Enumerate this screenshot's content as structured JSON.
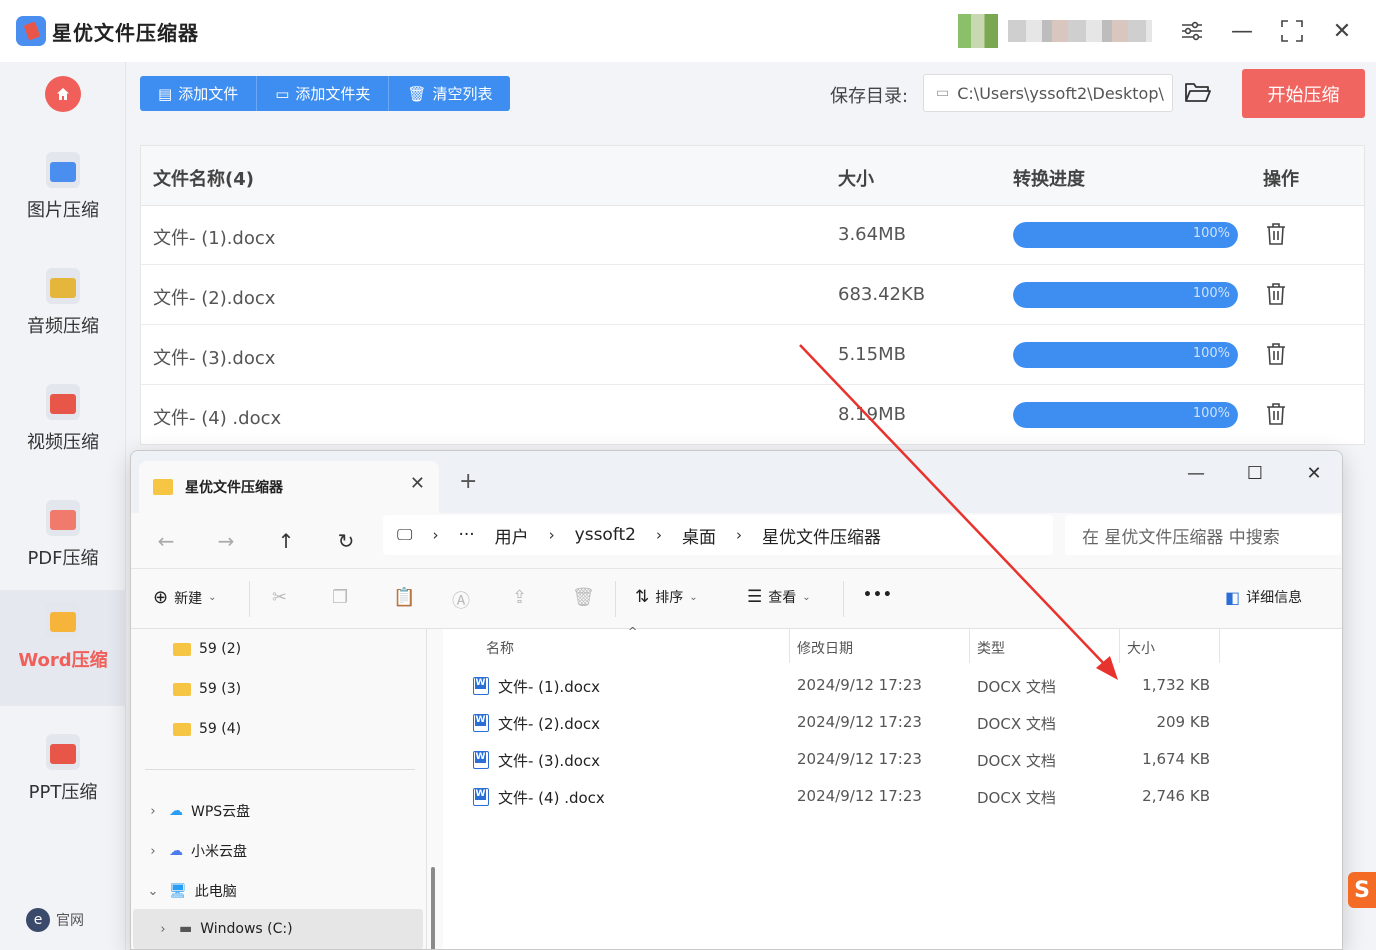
{
  "app": {
    "title": "星优文件压缩器",
    "window_controls": {
      "settings_icon": "sliders-icon",
      "minimize": "—",
      "maximize": "⛶",
      "close": "✕"
    }
  },
  "sidebar": {
    "home_icon": "home-icon",
    "items": [
      {
        "label": "图片压缩",
        "icon": "image-icon",
        "color": "#4a8ff0"
      },
      {
        "label": "音频压缩",
        "icon": "audio-icon",
        "color": "#e6b63c"
      },
      {
        "label": "视频压缩",
        "icon": "video-icon",
        "color": "#e8564a"
      },
      {
        "label": "PDF压缩",
        "icon": "pdf-icon",
        "color": "#f07a6c"
      },
      {
        "label": "Word压缩",
        "icon": "word-icon",
        "color": "#f6b43a",
        "active": true
      },
      {
        "label": "PPT压缩",
        "icon": "ppt-icon",
        "color": "#e8564a"
      }
    ],
    "site_link": {
      "icon_text": "e",
      "label": "官网"
    }
  },
  "toolbar": {
    "add_file": "添加文件",
    "add_folder": "添加文件夹",
    "clear_list": "清空列表",
    "save_dir_label": "保存目录:",
    "save_dir_path": "C:\\Users\\yssoft2\\Desktop\\",
    "start_button": "开始压缩"
  },
  "file_table": {
    "headers": {
      "name": "文件名称(4)",
      "size": "大小",
      "progress": "转换进度",
      "action": "操作"
    },
    "rows": [
      {
        "name": "文件- (1).docx",
        "size": "3.64MB",
        "progress": 1.0,
        "progress_label": "100%"
      },
      {
        "name": "文件- (2).docx",
        "size": "683.42KB",
        "progress": 1.0,
        "progress_label": "100%"
      },
      {
        "name": "文件- (3).docx",
        "size": "5.15MB",
        "progress": 1.0,
        "progress_label": "100%"
      },
      {
        "name": "文件- (4) .docx",
        "size": "8.19MB",
        "progress": 1.0,
        "progress_label": "100%"
      }
    ]
  },
  "explorer": {
    "tab_title": "星优文件压缩器",
    "tab_close": "✕",
    "new_tab": "+",
    "controls": {
      "minimize": "—",
      "maximize": "☐",
      "close": "✕"
    },
    "address": [
      "用户",
      "yssoft2",
      "桌面",
      "星优文件压缩器"
    ],
    "address_more": "···",
    "address_sep": "›",
    "search_placeholder": "在 星优文件压缩器 中搜索",
    "commands": {
      "new": "新建",
      "sort": "排序",
      "view": "查看",
      "more": "•••",
      "details": "详细信息"
    },
    "nav_tree": [
      {
        "label": "59 (2)",
        "type": "folder"
      },
      {
        "label": "59 (3)",
        "type": "folder"
      },
      {
        "label": "59 (4)",
        "type": "folder"
      },
      {
        "label": "WPS云盘",
        "type": "cloud"
      },
      {
        "label": "小米云盘",
        "type": "cloud"
      },
      {
        "label": "此电脑",
        "type": "pc"
      },
      {
        "label": "Windows (C:)",
        "type": "drive"
      }
    ],
    "columns": {
      "name": "名称",
      "modified": "修改日期",
      "type": "类型",
      "size": "大小"
    },
    "files": [
      {
        "name": "文件- (1).docx",
        "modified": "2024/9/12 17:23",
        "type": "DOCX 文档",
        "size": "1,732 KB"
      },
      {
        "name": "文件- (2).docx",
        "modified": "2024/9/12 17:23",
        "type": "DOCX 文档",
        "size": "209 KB"
      },
      {
        "name": "文件- (3).docx",
        "modified": "2024/9/12 17:23",
        "type": "DOCX 文档",
        "size": "1,674 KB"
      },
      {
        "name": "文件- (4) .docx",
        "modified": "2024/9/12 17:23",
        "type": "DOCX 文档",
        "size": "2,746 KB"
      }
    ]
  },
  "colors": {
    "primary": "#3d8ef0",
    "accent": "#f16561",
    "annotation_arrow": "#e8322d"
  }
}
